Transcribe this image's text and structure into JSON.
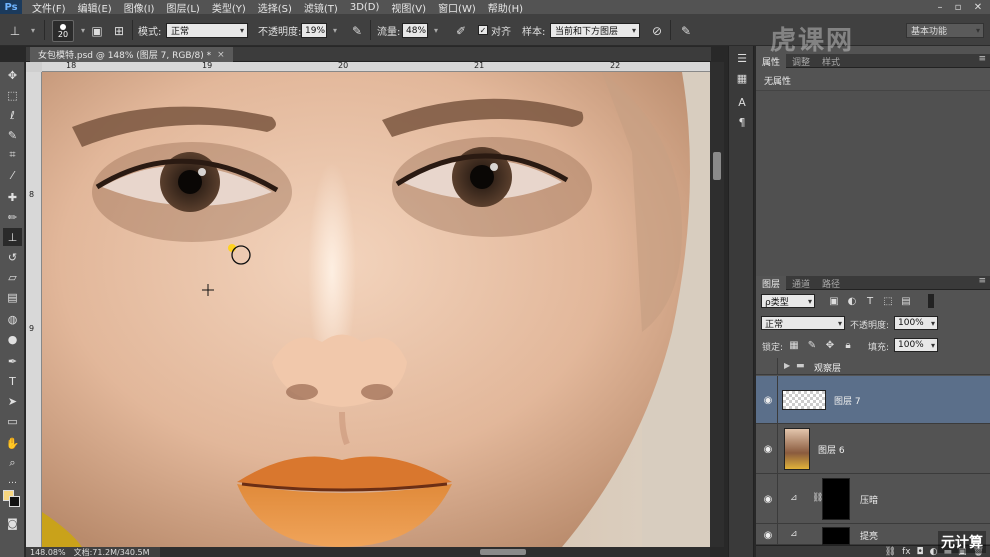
{
  "app": {
    "logo": "Ps"
  },
  "menu": [
    "文件(F)",
    "编辑(E)",
    "图像(I)",
    "图层(L)",
    "类型(Y)",
    "选择(S)",
    "滤镜(T)",
    "3D(D)",
    "视图(V)",
    "窗口(W)",
    "帮助(H)"
  ],
  "options": {
    "brush_size": "20",
    "mode_label": "模式:",
    "mode_value": "正常",
    "opacity_label": "不透明度:",
    "opacity_value": "19%",
    "flow_label": "流量:",
    "flow_value": "48%",
    "align_label": "对齐",
    "sample_label": "样本:",
    "sample_value": "当前和下方图层",
    "workspace": "基本功能"
  },
  "document": {
    "tab_title": "女包模特.psd @ 148% (图层 7, RGB/8) *",
    "close": "×",
    "zoom": "148.08%",
    "doc_size": "文档:71.2M/340.5M",
    "ruler_h": [
      "18",
      "19",
      "20",
      "21",
      "22"
    ],
    "ruler_v": [
      "8",
      "9"
    ]
  },
  "properties": {
    "tabs": [
      "属性",
      "调整",
      "样式"
    ],
    "no_props": "无属性"
  },
  "layers": {
    "tabs": [
      "图层",
      "通道",
      "路径"
    ],
    "filter_kind": "ρ类型",
    "blend_mode": "正常",
    "opacity_label": "不透明度:",
    "opacity_value": "100%",
    "lock_label": "锁定:",
    "fill_label": "填充:",
    "fill_value": "100%",
    "items": [
      {
        "name": "观察层",
        "type": "group"
      },
      {
        "name": "图层 7",
        "type": "layer"
      },
      {
        "name": "图层 6",
        "type": "layer"
      },
      {
        "name": "压暗",
        "type": "adjustment"
      },
      {
        "name": "提亮",
        "type": "adjustment"
      }
    ],
    "bottom_icons": [
      "link-icon",
      "fx-icon",
      "mask-icon",
      "adjustment-icon",
      "folder-icon",
      "new-layer-icon",
      "trash-icon"
    ]
  },
  "watermarks": {
    "brand": "虎课网",
    "corner": "元计算"
  },
  "colors": {
    "foreground": "#f7d680",
    "background": "#111111",
    "selected_layer": "#5b6f8a"
  }
}
